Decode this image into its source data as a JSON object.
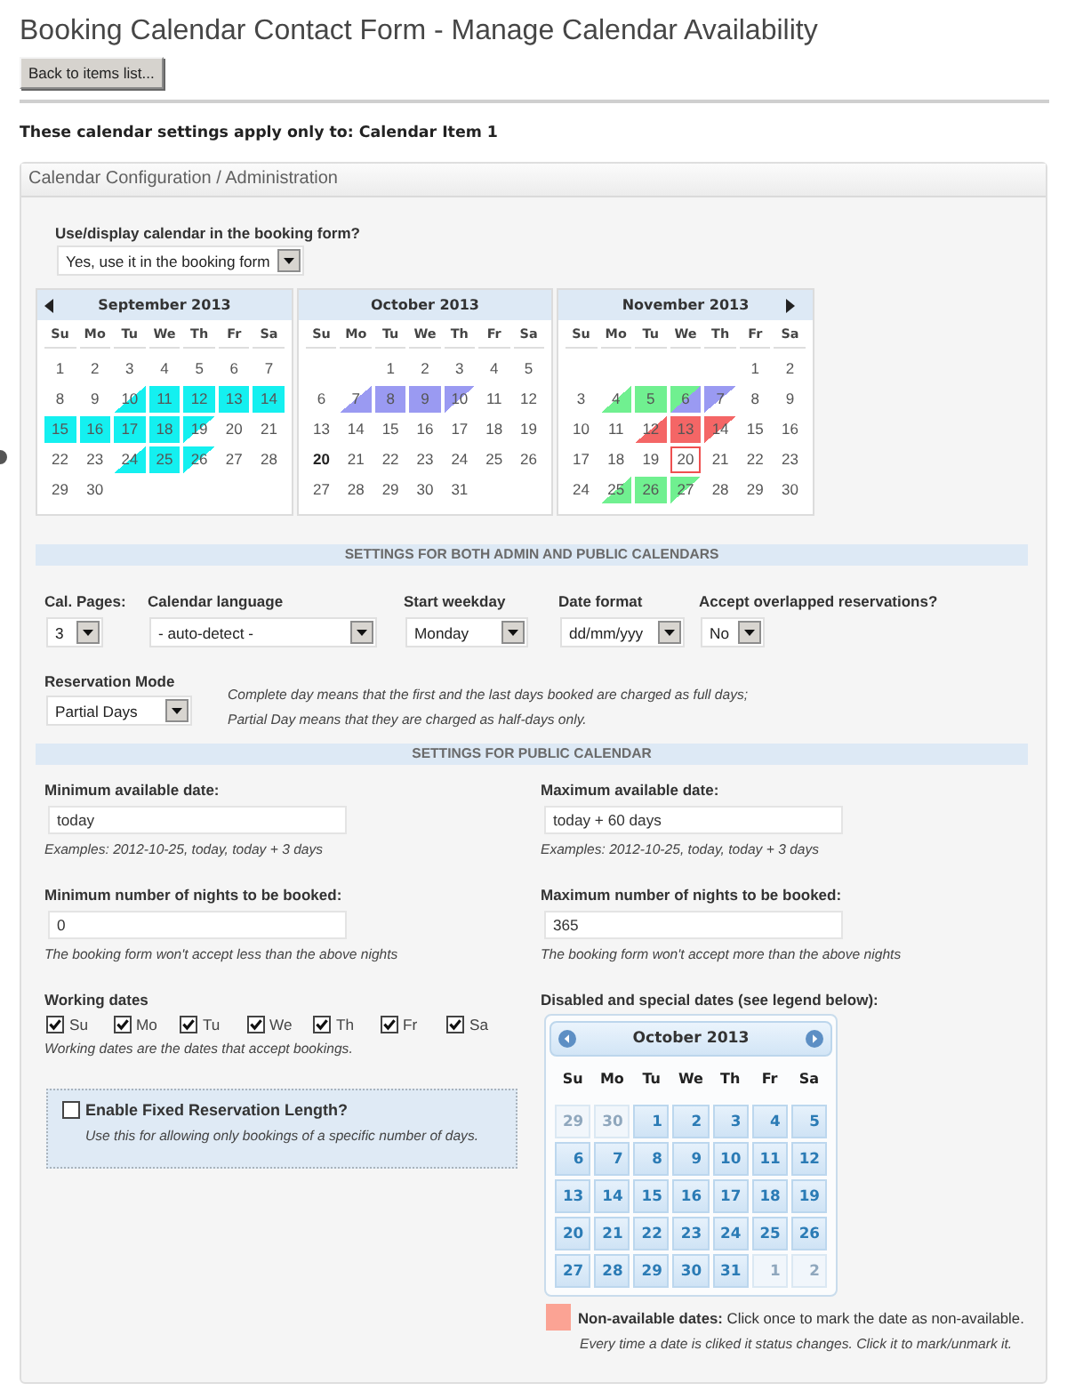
{
  "header": {
    "title": "Booking Calendar Contact Form - Manage Calendar Availability",
    "back_button": "Back to items list...",
    "scope_note": "These calendar settings apply only to: Calendar Item 1"
  },
  "panel": {
    "title": "Calendar Configuration / Administration"
  },
  "display_setting": {
    "label": "Use/display calendar in the booking form?",
    "value": "Yes, use it in the booking form"
  },
  "admin_calendar": {
    "months": [
      {
        "title": "September 2013",
        "weekdays": [
          "Su",
          "Mo",
          "Tu",
          "We",
          "Th",
          "Fr",
          "Sa"
        ],
        "weeks": [
          [
            {
              "day": "1",
              "kind": "day"
            },
            {
              "day": "2",
              "kind": "day"
            },
            {
              "day": "3",
              "kind": "day"
            },
            {
              "day": "4",
              "kind": "day"
            },
            {
              "day": "5",
              "kind": "day"
            },
            {
              "day": "6",
              "kind": "day"
            },
            {
              "day": "7",
              "kind": "day"
            }
          ],
          [
            {
              "day": "8",
              "kind": "day"
            },
            {
              "day": "9",
              "kind": "day"
            },
            {
              "day": "10",
              "kind": "day",
              "marks": [
                {
                  "kind": "pm",
                  "color": "#14f0f0"
                }
              ]
            },
            {
              "day": "11",
              "kind": "day",
              "marks": [
                {
                  "kind": "full",
                  "color": "#14f0f0"
                }
              ]
            },
            {
              "day": "12",
              "kind": "day",
              "marks": [
                {
                  "kind": "full",
                  "color": "#14f0f0"
                }
              ]
            },
            {
              "day": "13",
              "kind": "day",
              "marks": [
                {
                  "kind": "full",
                  "color": "#14f0f0"
                }
              ]
            },
            {
              "day": "14",
              "kind": "day",
              "marks": [
                {
                  "kind": "full",
                  "color": "#14f0f0"
                }
              ]
            }
          ],
          [
            {
              "day": "15",
              "kind": "day",
              "marks": [
                {
                  "kind": "full",
                  "color": "#14f0f0"
                }
              ]
            },
            {
              "day": "16",
              "kind": "day",
              "marks": [
                {
                  "kind": "full",
                  "color": "#14f0f0"
                }
              ]
            },
            {
              "day": "17",
              "kind": "day",
              "marks": [
                {
                  "kind": "full",
                  "color": "#14f0f0"
                }
              ]
            },
            {
              "day": "18",
              "kind": "day",
              "marks": [
                {
                  "kind": "full",
                  "color": "#14f0f0"
                }
              ]
            },
            {
              "day": "19",
              "kind": "day",
              "marks": [
                {
                  "kind": "am",
                  "color": "#14f0f0"
                }
              ]
            },
            {
              "day": "20",
              "kind": "day"
            },
            {
              "day": "21",
              "kind": "day"
            }
          ],
          [
            {
              "day": "22",
              "kind": "day"
            },
            {
              "day": "23",
              "kind": "day"
            },
            {
              "day": "24",
              "kind": "day",
              "marks": [
                {
                  "kind": "pm",
                  "color": "#14f0f0"
                }
              ]
            },
            {
              "day": "25",
              "kind": "day",
              "marks": [
                {
                  "kind": "full",
                  "color": "#14f0f0"
                }
              ]
            },
            {
              "day": "26",
              "kind": "day",
              "marks": [
                {
                  "kind": "am",
                  "color": "#14f0f0"
                }
              ]
            },
            {
              "day": "27",
              "kind": "day"
            },
            {
              "day": "28",
              "kind": "day"
            }
          ],
          [
            {
              "day": "29",
              "kind": "day"
            },
            {
              "day": "30",
              "kind": "day"
            }
          ]
        ]
      },
      {
        "title": "October 2013",
        "weekdays": [
          "Su",
          "Mo",
          "Tu",
          "We",
          "Th",
          "Fr",
          "Sa"
        ],
        "weeks": [
          [
            {
              "day": "1",
              "kind": "day"
            },
            {
              "day": "2",
              "kind": "day"
            },
            {
              "day": "3",
              "kind": "day"
            },
            {
              "day": "4",
              "kind": "day"
            },
            {
              "day": "5",
              "kind": "day"
            }
          ],
          [
            {
              "day": "6",
              "kind": "day"
            },
            {
              "day": "7",
              "kind": "day",
              "marks": [
                {
                  "kind": "pm",
                  "color": "#9a9af2"
                }
              ]
            },
            {
              "day": "8",
              "kind": "day",
              "marks": [
                {
                  "kind": "full",
                  "color": "#9a9af2"
                }
              ]
            },
            {
              "day": "9",
              "kind": "day",
              "marks": [
                {
                  "kind": "full",
                  "color": "#9a9af2"
                }
              ]
            },
            {
              "day": "10",
              "kind": "day",
              "marks": [
                {
                  "kind": "am",
                  "color": "#9a9af2"
                }
              ]
            },
            {
              "day": "11",
              "kind": "day"
            },
            {
              "day": "12",
              "kind": "day"
            }
          ],
          [
            {
              "day": "13",
              "kind": "day"
            },
            {
              "day": "14",
              "kind": "day"
            },
            {
              "day": "15",
              "kind": "day"
            },
            {
              "day": "16",
              "kind": "day"
            },
            {
              "day": "17",
              "kind": "day"
            },
            {
              "day": "18",
              "kind": "day"
            },
            {
              "day": "19",
              "kind": "day"
            }
          ],
          [
            {
              "day": "20",
              "kind": "today"
            },
            {
              "day": "21",
              "kind": "day"
            },
            {
              "day": "22",
              "kind": "day"
            },
            {
              "day": "23",
              "kind": "day"
            },
            {
              "day": "24",
              "kind": "day"
            },
            {
              "day": "25",
              "kind": "day"
            },
            {
              "day": "26",
              "kind": "day"
            }
          ],
          [
            {
              "day": "27",
              "kind": "day"
            },
            {
              "day": "28",
              "kind": "day"
            },
            {
              "day": "29",
              "kind": "day"
            },
            {
              "day": "30",
              "kind": "day"
            },
            {
              "day": "31",
              "kind": "day"
            }
          ]
        ]
      },
      {
        "title": "November 2013",
        "weekdays": [
          "Su",
          "Mo",
          "Tu",
          "We",
          "Th",
          "Fr",
          "Sa"
        ],
        "weeks": [
          [
            {
              "day": "1",
              "kind": "day"
            },
            {
              "day": "2",
              "kind": "day"
            }
          ],
          [
            {
              "day": "3",
              "kind": "day"
            },
            {
              "day": "4",
              "kind": "day",
              "marks": [
                {
                  "kind": "pm",
                  "color": "#70f090"
                }
              ]
            },
            {
              "day": "5",
              "kind": "day",
              "marks": [
                {
                  "kind": "full",
                  "color": "#70f090"
                }
              ]
            },
            {
              "day": "6",
              "kind": "day",
              "marks": [
                {
                  "kind": "am",
                  "color": "#70f090"
                },
                {
                  "kind": "pm",
                  "color": "#9a9af2"
                }
              ]
            },
            {
              "day": "7",
              "kind": "day",
              "marks": [
                {
                  "kind": "am",
                  "color": "#9a9af2"
                }
              ]
            },
            {
              "day": "8",
              "kind": "day"
            },
            {
              "day": "9",
              "kind": "day"
            }
          ],
          [
            {
              "day": "10",
              "kind": "day"
            },
            {
              "day": "11",
              "kind": "day"
            },
            {
              "day": "12",
              "kind": "day",
              "marks": [
                {
                  "kind": "pm",
                  "color": "#f46666"
                }
              ]
            },
            {
              "day": "13",
              "kind": "day",
              "marks": [
                {
                  "kind": "full",
                  "color": "#f46666"
                }
              ]
            },
            {
              "day": "14",
              "kind": "day",
              "marks": [
                {
                  "kind": "am",
                  "color": "#f46666"
                }
              ]
            },
            {
              "day": "15",
              "kind": "day"
            },
            {
              "day": "16",
              "kind": "day"
            }
          ],
          [
            {
              "day": "17",
              "kind": "day"
            },
            {
              "day": "18",
              "kind": "day"
            },
            {
              "day": "19",
              "kind": "day"
            },
            {
              "day": "20",
              "kind": "focus"
            },
            {
              "day": "21",
              "kind": "day"
            },
            {
              "day": "22",
              "kind": "day"
            },
            {
              "day": "23",
              "kind": "day"
            }
          ],
          [
            {
              "day": "24",
              "kind": "day"
            },
            {
              "day": "25",
              "kind": "day",
              "marks": [
                {
                  "kind": "pm",
                  "color": "#70f090"
                }
              ]
            },
            {
              "day": "26",
              "kind": "day",
              "marks": [
                {
                  "kind": "full",
                  "color": "#70f090"
                }
              ]
            },
            {
              "day": "27",
              "kind": "day",
              "marks": [
                {
                  "kind": "am",
                  "color": "#70f090"
                }
              ]
            },
            {
              "day": "28",
              "kind": "day"
            },
            {
              "day": "29",
              "kind": "day"
            },
            {
              "day": "30",
              "kind": "day"
            }
          ]
        ]
      }
    ]
  },
  "general_settings": {
    "heading": "SETTINGS FOR BOTH ADMIN AND PUBLIC CALENDARS",
    "fields": [
      {
        "label": "Cal. Pages:",
        "value": "3"
      },
      {
        "label": "Calendar language",
        "value": "- auto-detect -"
      },
      {
        "label": "Start weekday",
        "value": "Monday"
      },
      {
        "label": "Date format",
        "value": "dd/mm/yyy"
      },
      {
        "label": "Accept overlapped reservations?",
        "value": "No"
      }
    ],
    "reservation_mode": {
      "label": "Reservation Mode",
      "value": "Partial Days",
      "notes": [
        "Complete day means that the first and the last days booked are charged as full days;",
        "Partial Day means that they are charged as half-days only."
      ]
    }
  },
  "public_settings": {
    "heading": "SETTINGS FOR PUBLIC CALENDAR",
    "date_limits": [
      {
        "label": "Minimum available date:",
        "value": "today",
        "hint": "Examples: 2012-10-25, today, today + 3 days"
      },
      {
        "label": "Maximum available date:",
        "value": "today + 60 days",
        "hint": "Examples: 2012-10-25, today, today + 3 days"
      }
    ],
    "night_limits": [
      {
        "label": "Minimum number of nights to be booked:",
        "value": "0",
        "hint": "The booking form won't accept less than the above nights"
      },
      {
        "label": "Maximum number of nights to be booked:",
        "value": "365",
        "hint": "The booking form won't accept more than the above nights"
      }
    ],
    "working_dates": {
      "label": "Working dates",
      "days": [
        {
          "label": "Su",
          "checked": true
        },
        {
          "label": "Mo",
          "checked": true
        },
        {
          "label": "Tu",
          "checked": true
        },
        {
          "label": "We",
          "checked": true
        },
        {
          "label": "Th",
          "checked": true
        },
        {
          "label": "Fr",
          "checked": true
        },
        {
          "label": "Sa",
          "checked": true
        }
      ],
      "hint": "Working dates are the dates that accept bookings."
    },
    "fixed_length": {
      "label": "Enable Fixed Reservation Length?",
      "checked": false,
      "hint": "Use this for allowing only bookings of a specific number of days."
    },
    "special_dates": {
      "label": "Disabled and special dates (see legend below):",
      "calendar": {
        "title": "October 2013",
        "weekdays": [
          "Su",
          "Mo",
          "Tu",
          "We",
          "Th",
          "Fr",
          "Sa"
        ],
        "weeks": [
          [
            {
              "day": "29",
              "outside": true
            },
            {
              "day": "30",
              "outside": true
            },
            {
              "day": "1",
              "outside": false
            },
            {
              "day": "2",
              "outside": false
            },
            {
              "day": "3",
              "outside": false
            },
            {
              "day": "4",
              "outside": false
            },
            {
              "day": "5",
              "outside": false
            }
          ],
          [
            {
              "day": "6",
              "outside": false
            },
            {
              "day": "7",
              "outside": false
            },
            {
              "day": "8",
              "outside": false
            },
            {
              "day": "9",
              "outside": false
            },
            {
              "day": "10",
              "outside": false
            },
            {
              "day": "11",
              "outside": false
            },
            {
              "day": "12",
              "outside": false
            }
          ],
          [
            {
              "day": "13",
              "outside": false
            },
            {
              "day": "14",
              "outside": false
            },
            {
              "day": "15",
              "outside": false
            },
            {
              "day": "16",
              "outside": false
            },
            {
              "day": "17",
              "outside": false
            },
            {
              "day": "18",
              "outside": false
            },
            {
              "day": "19",
              "outside": false
            }
          ],
          [
            {
              "day": "20",
              "outside": false
            },
            {
              "day": "21",
              "outside": false
            },
            {
              "day": "22",
              "outside": false
            },
            {
              "day": "23",
              "outside": false
            },
            {
              "day": "24",
              "outside": false
            },
            {
              "day": "25",
              "outside": false
            },
            {
              "day": "26",
              "outside": false
            }
          ],
          [
            {
              "day": "27",
              "outside": false
            },
            {
              "day": "28",
              "outside": false
            },
            {
              "day": "29",
              "outside": false
            },
            {
              "day": "30",
              "outside": false
            },
            {
              "day": "31",
              "outside": false
            },
            {
              "day": "1",
              "outside": true
            },
            {
              "day": "2",
              "outside": true
            }
          ]
        ]
      },
      "legend": [
        {
          "color": "#fba394",
          "text": "**Non-available dates:** Click once to mark the date as non-available.",
          "note": "Every time a date is cliked it status changes. Click it to mark/unmark it."
        }
      ]
    }
  }
}
